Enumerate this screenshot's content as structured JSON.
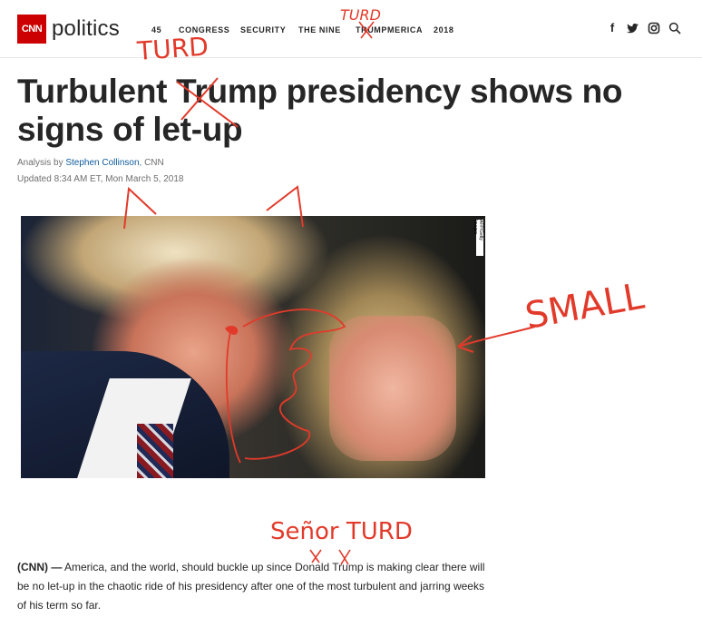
{
  "brand": {
    "logo_mark": "CNN",
    "section": "politics"
  },
  "nav": {
    "items": [
      "45",
      "CONGRESS",
      "SECURITY",
      "THE NINE",
      "TRUMPMERICA",
      "2018"
    ]
  },
  "social": {
    "icons": [
      "facebook-icon",
      "twitter-icon",
      "instagram-icon",
      "search-icon"
    ],
    "glyphs": [
      "f",
      "❦",
      "▣",
      "⌕"
    ]
  },
  "article": {
    "headline": "Turbulent Trump presidency shows no signs of let-up",
    "byline_prefix": "Analysis by ",
    "author": "Stephen Collinson",
    "byline_suffix": ", CNN",
    "updated": "Updated 8:34 AM ET, Mon March 5, 2018",
    "photo_credit": "AFP/Getty Images",
    "lead_label": "(CNN) —",
    "lead_text": " America, and the world, should buckle up since Donald Trump is making clear there will be no let-up in the chaotic ride of his presidency after one of the most turbulent and jarring weeks of his term so far."
  },
  "annotations": {
    "nav_note": "TURD",
    "headline_note": "TURD",
    "photo_note": "SMALL",
    "body_note": "Señor TURD"
  },
  "colors": {
    "brand_red": "#cc0000",
    "link_blue": "#0c5a9b",
    "annotation_red": "#e23a2a",
    "text_dark": "#262626"
  }
}
